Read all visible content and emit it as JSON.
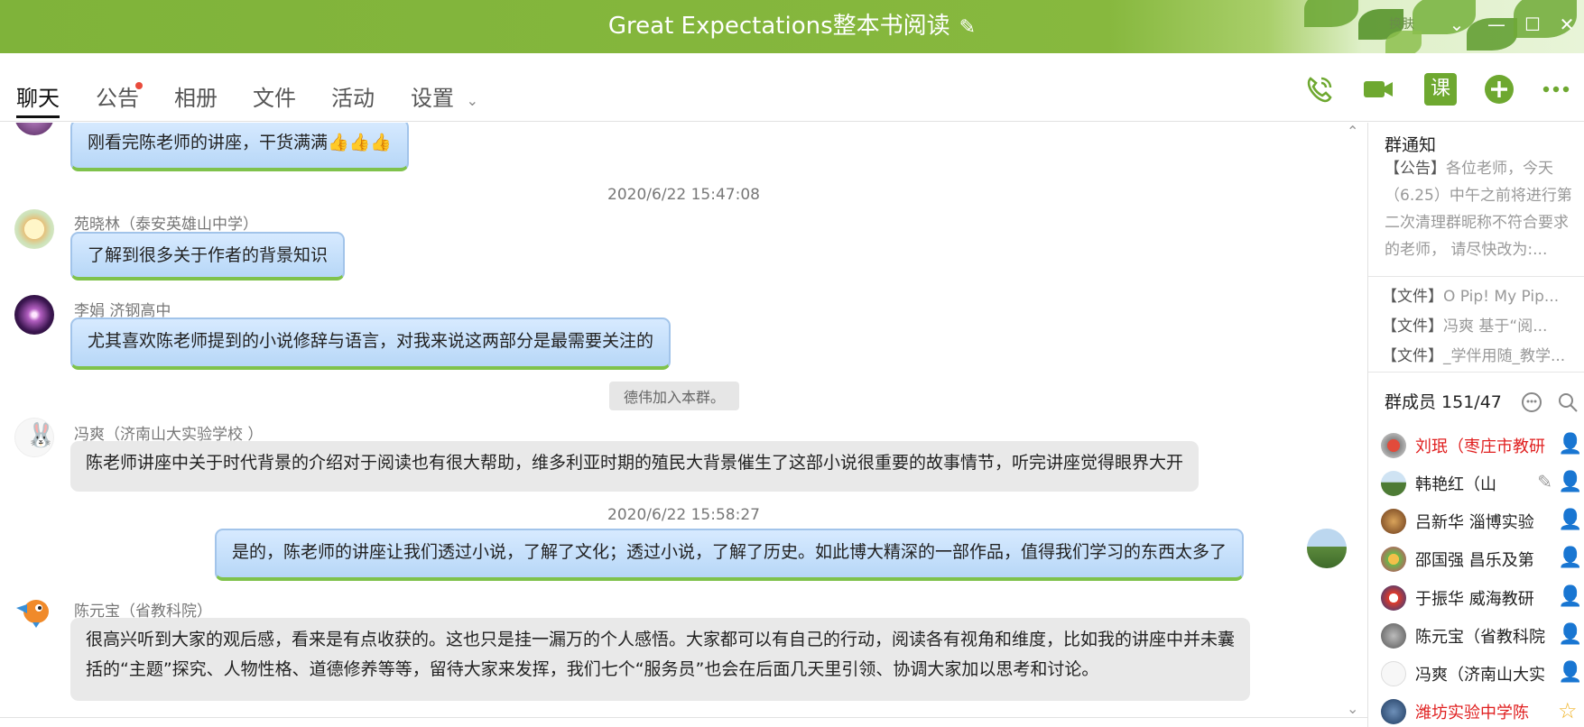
{
  "window": {
    "title": "Great Expectations整本书阅读",
    "skin_label": "换肤",
    "controls": [
      "⌄",
      "—",
      "☐",
      "✕"
    ]
  },
  "tabs": [
    {
      "label": "聊天",
      "active": true
    },
    {
      "label": "公告",
      "has_dot": true
    },
    {
      "label": "相册"
    },
    {
      "label": "文件"
    },
    {
      "label": "活动"
    },
    {
      "label": "设置"
    }
  ],
  "toolbar_icons": [
    "phone-icon",
    "video-call-icon",
    "class-icon",
    "add-icon",
    "more-icon"
  ],
  "toolbar": {
    "class_label": "课"
  },
  "chat": {
    "messages": [
      {
        "text": "刚看完陈老师的讲座，干货满满👍👍👍",
        "style": "blue"
      },
      {
        "time": "2020/6/22 15:47:08"
      },
      {
        "sender": "苑晓林（泰安英雄山中学）",
        "text": "了解到很多关于作者的背景知识",
        "style": "blue"
      },
      {
        "sender": "李娟 济钢高中",
        "text": "尤其喜欢陈老师提到的小说修辞与语言，对我来说这两部分是最需要关注的",
        "style": "blue"
      },
      {
        "system": "德伟加入本群。"
      },
      {
        "sender": "冯爽（济南山大实验学校 ）",
        "text": "陈老师讲座中关于时代背景的介绍对于阅读也有很大帮助，维多利亚时期的殖民大背景催生了这部小说很重要的故事情节，听完讲座觉得眼界大开",
        "style": "grey"
      },
      {
        "time": "2020/6/22 15:58:27"
      },
      {
        "self": true,
        "text": "是的，陈老师的讲座让我们透过小说，了解了文化；透过小说，了解了历史。如此博大精深的一部作品，值得我们学习的东西太多了",
        "style": "blue"
      },
      {
        "sender": "陈元宝（省教科院）",
        "text_line1": "很高兴听到大家的观后感，看来是有点收获的。这也只是挂一漏万的个人感悟。大家都可以有自己的行动，阅读各有视角和维度，比如我的讲座中并未囊",
        "text_line2": "括的“主题”探究、人物性格、道德修养等等，留待大家来发挥，我们七个“服务员”也会在后面几天里引领、协调大家加以思考和讨论。",
        "style": "grey"
      }
    ]
  },
  "side": {
    "notice_title": "群通知",
    "notice_tag": "【公告】",
    "notice_text": "各位老师，今天（6.25）中午之前将进行第二次清理群昵称不符合要求的老师， 请尽快改为:...",
    "files": [
      {
        "tag": "【文件】",
        "name": "O Pip! My Pip..."
      },
      {
        "tag": "【文件】",
        "name": "冯爽 基于“阅..."
      },
      {
        "tag": "【文件】",
        "name": "_学伴用随_教学..."
      }
    ],
    "members_title": "群成员 151/47",
    "members": [
      {
        "name": "刘珉（枣庄市教研",
        "color": "#e02020"
      },
      {
        "name": "韩艳红（山",
        "color": "#222222"
      },
      {
        "name": "吕新华  淄博实验",
        "color": "#222222"
      },
      {
        "name": "邵国强 昌乐及第",
        "color": "#222222"
      },
      {
        "name": "于振华 威海教研",
        "color": "#222222"
      },
      {
        "name": "陈元宝（省教科院",
        "color": "#222222"
      },
      {
        "name": "冯爽（济南山大实",
        "color": "#222222"
      },
      {
        "name": "潍坊实验中学陈",
        "color": "#e02020"
      }
    ]
  },
  "colors": {
    "accent_green": "#7fb33a",
    "bubble_blue": "#c5e0fb",
    "owner_red": "#e02020"
  }
}
